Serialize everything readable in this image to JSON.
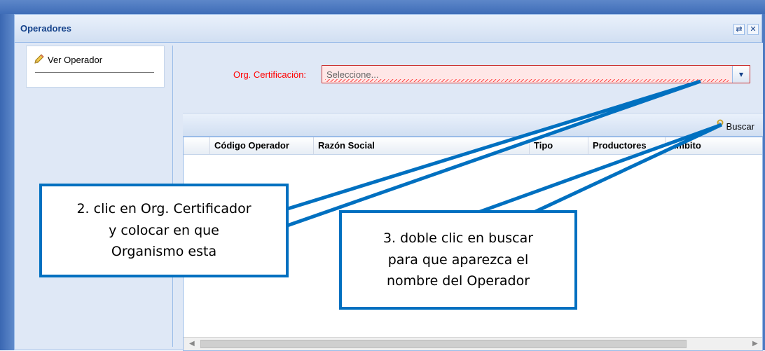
{
  "window": {
    "title": "Operadores",
    "tools": [
      {
        "icon": "refresh-icon",
        "glyph": "⇄"
      },
      {
        "icon": "close-icon",
        "glyph": "✕"
      }
    ]
  },
  "sidebar": {
    "items": [
      {
        "label": "Ver Operador",
        "icon": "pencil-icon"
      }
    ]
  },
  "form": {
    "org_label": "Org. Certificación:",
    "org_placeholder": "Seleccione...",
    "invalid_color": "#ff0000"
  },
  "toolbar": {
    "buscar_label": "Buscar",
    "buscar_icon": "wrench-icon"
  },
  "grid": {
    "columns": [
      "Código Operador",
      "Razón Social",
      "Tipo",
      "Productores",
      "Ámbito"
    ]
  },
  "annotations": {
    "callout_2": [
      "2. clic en Org. Certificador",
      "y colocar en que",
      "Organismo esta"
    ],
    "callout_3": [
      "3. doble clic en buscar",
      "para que aparezca el",
      "nombre del Operador"
    ],
    "color": "#0070c0"
  }
}
